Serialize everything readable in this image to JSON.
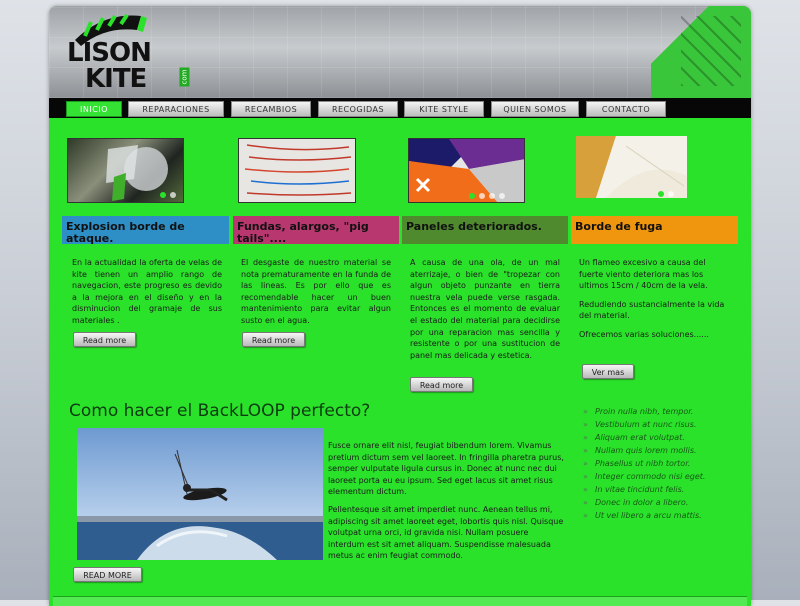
{
  "logo": {
    "line1": "LISON",
    "line2": "KITE",
    "suffix": "com"
  },
  "nav": [
    "INICIO",
    "REPARACIONES",
    "RECAMBIOS",
    "RECOGIDAS",
    "KITE STYLE",
    "QUIEN SOMOS",
    "CONTACTO"
  ],
  "features": [
    {
      "title": "Explosion borde de ataque.",
      "color": "#2d8fc6",
      "paragraphs": [
        "En la actualidad la oferta de velas de kite tienen un amplio rango de navegacion, este progreso es devido a la mejora en el diseño y en la disminucion del gramaje de sus materiales ."
      ],
      "button": "Read more"
    },
    {
      "title": "Fundas, alargos, \"pig tails\"....",
      "color": "#b8376f",
      "paragraphs": [
        "El desgaste de nuestro material se nota prematuramente en la funda de las lineas. Es por ello que es recomendable hacer un buen mantenimiento para evitar algun susto en el agua."
      ],
      "button": "Read more"
    },
    {
      "title": "Paneles deteriorados.",
      "color": "#4f8a2e",
      "paragraphs": [
        "A causa de una ola, de un mal aterrizaje, o bien de \"tropezar con algun objeto punzante en tierra  nuestra vela puede verse rasgada. Entonces es el momento de evaluar el estado del material para decidirse por una reparacion mas sencilla y resistente o por una sustitucion de panel mas delicada y estetica."
      ],
      "button": "Read more"
    },
    {
      "title": "Borde de fuga",
      "color": "#f0960e",
      "paragraphs": [
        "Un flameo excesivo a causa del fuerte viento deteriora mas los ultimos 15cm / 40cm de la vela.",
        "Redudiendo sustancialmente la vida del material.",
        "Ofrecemos varias soluciones......"
      ],
      "button": "Ver mas"
    }
  ],
  "article": {
    "title": "Como hacer el BackLOOP perfecto?",
    "paragraphs": [
      "Fusce ornare elit nisl, feugiat bibendum lorem. Vivamus pretium dictum sem vel laoreet. In fringilla pharetra purus, semper vulputate ligula cursus in. Donec at nunc nec dui laoreet porta eu eu ipsum. Sed eget lacus sit amet risus elementum dictum.",
      "Pellentesque sit amet imperdiet nunc. Aenean tellus mi, adipiscing sit amet laoreet eget, lobortis quis nisl. Quisque volutpat urna orci, id gravida nisi. Nullam posuere interdum est sit amet aliquam. Suspendisse malesuada metus ac enim feugiat commodo."
    ],
    "button": "READ MORE"
  },
  "sidebar_links": [
    "Proin nulla nibh, tempor.",
    "Vestibulum at nunc risus.",
    "Aliquam erat volutpat.",
    "Nullam quis lorem mollis.",
    "Phasellus ut nibh tortor.",
    "Integer commodo nisi eget.",
    "In vitae tincidunt felis.",
    "Donec in dolor a libero.",
    "Ut vel libero a arcu mattis."
  ],
  "colors": {
    "page_bg": "#2be22b",
    "nav_bg": "#070707",
    "nav_active": "#33e233",
    "article_title": "#0c3c10"
  }
}
